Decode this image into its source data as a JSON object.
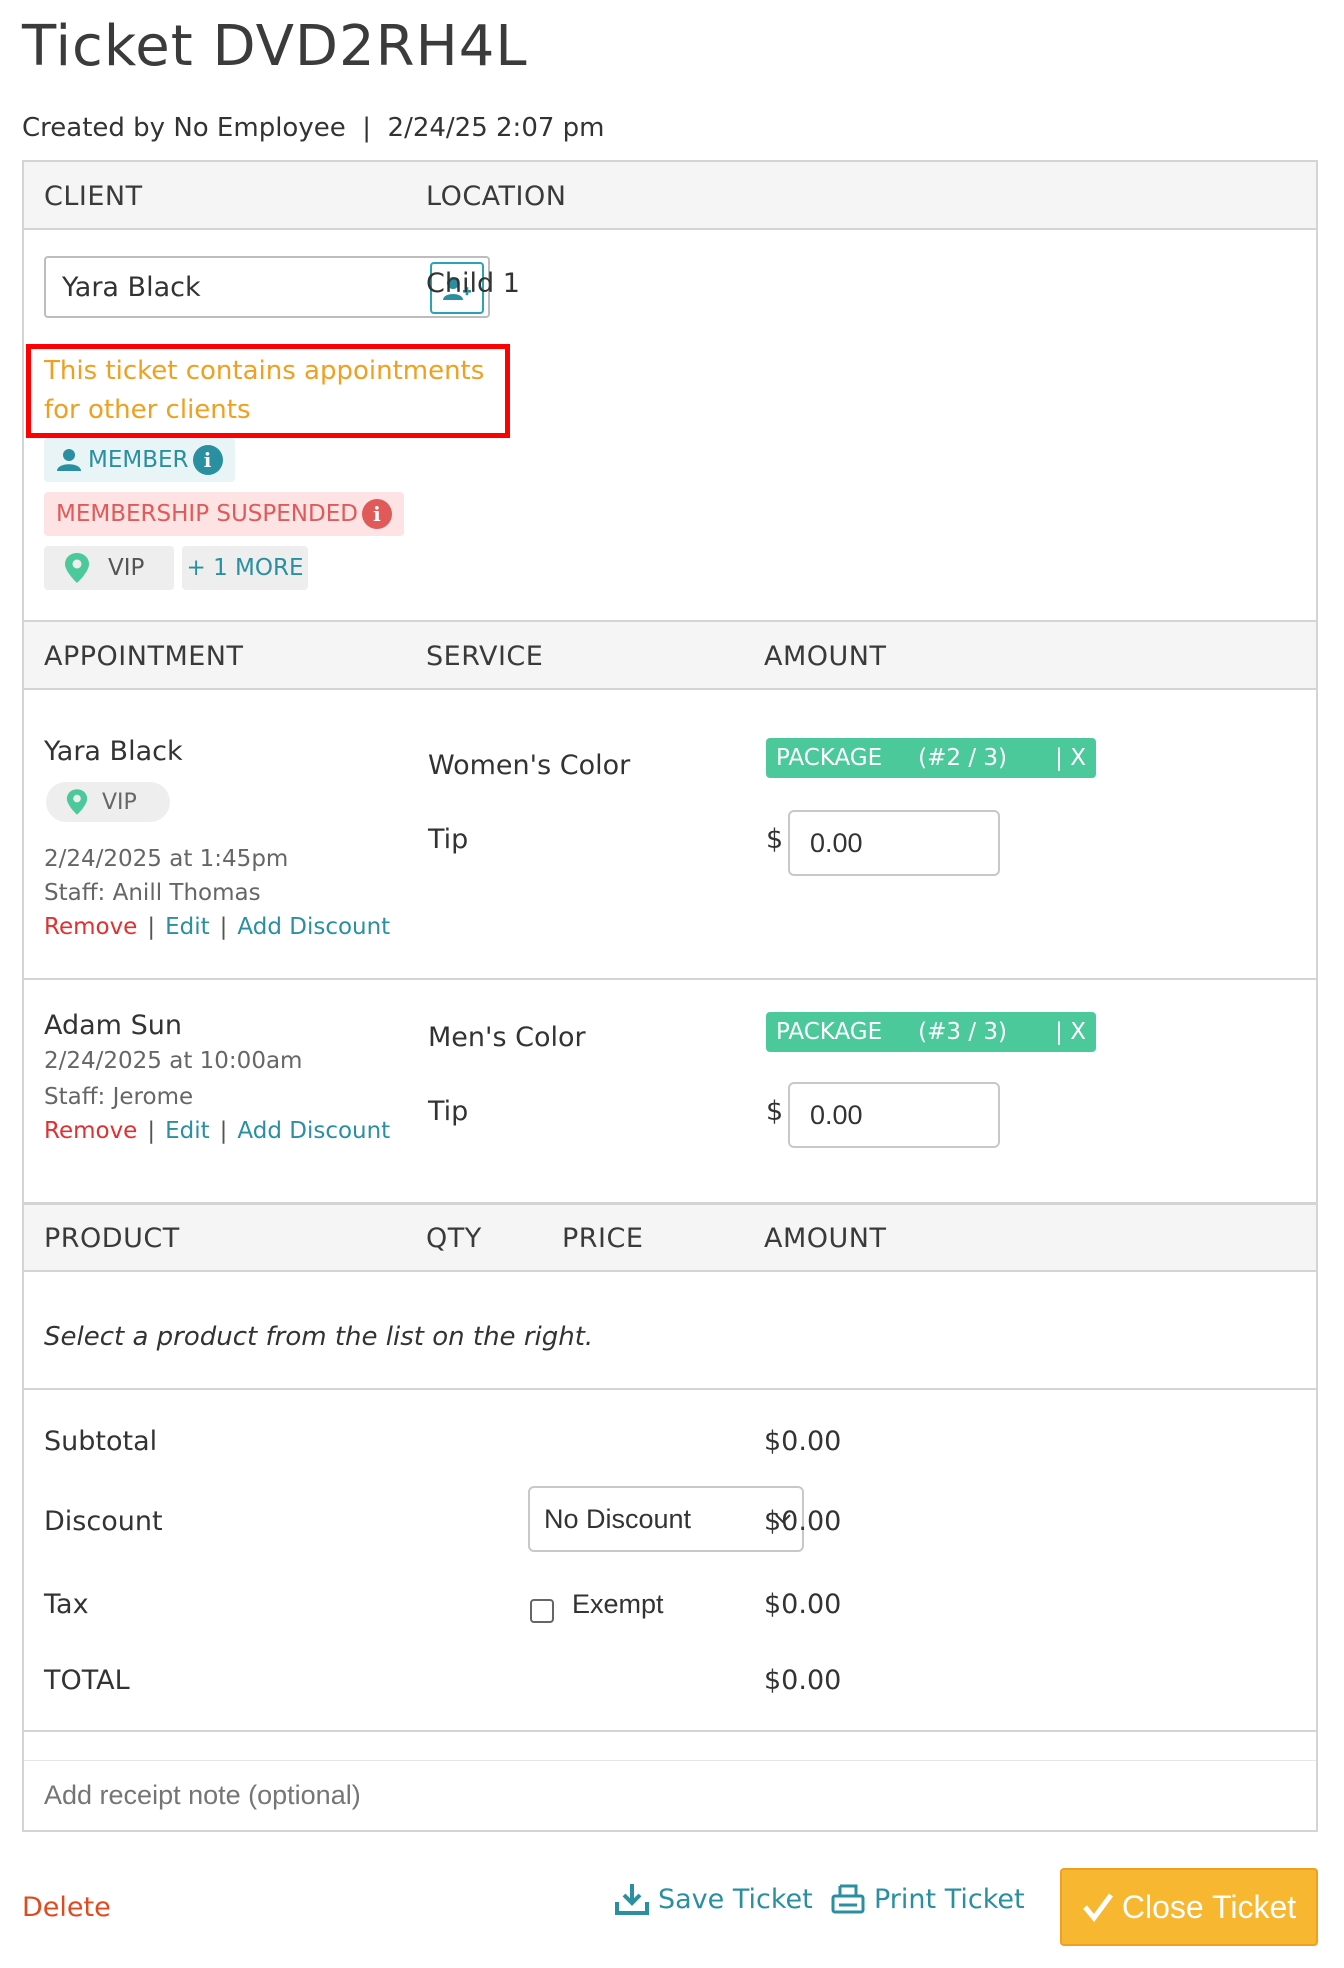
{
  "page": {
    "title": "Ticket DVD2RH4L",
    "created": "Created by No Employee  |  2/24/25 2:07 pm"
  },
  "client_section": {
    "client_header": "CLIENT",
    "location_header": "LOCATION",
    "client_name": "Yara Black",
    "warning": "This ticket contains appointments for other clients",
    "tags": {
      "member": "MEMBER",
      "suspended": "MEMBERSHIP SUSPENDED",
      "vip": "VIP",
      "more": "+ 1 MORE"
    },
    "location": "Child 1"
  },
  "appointments": {
    "headers": {
      "appointment": "APPOINTMENT",
      "service": "SERVICE",
      "amount": "AMOUNT"
    },
    "items": [
      {
        "client": "Yara Black",
        "tag": "VIP",
        "datetime": "2/24/2025 at 1:45pm",
        "staff": "Staff: Anill Thomas",
        "service": "Women's Color",
        "tip_label": "Tip",
        "badge_label": "PACKAGE",
        "badge_count": "(#2 / 3)",
        "badge_close": "| X",
        "currency": "$",
        "tip_value": "0.00"
      },
      {
        "client": "Adam Sun",
        "datetime": "2/24/2025 at 10:00am",
        "staff": "Staff: Jerome",
        "service": "Men's Color",
        "tip_label": "Tip",
        "badge_label": "PACKAGE",
        "badge_count": "(#3 / 3)",
        "badge_close": "| X",
        "currency": "$",
        "tip_value": "0.00"
      }
    ],
    "links": {
      "remove": "Remove",
      "edit": "Edit",
      "add_discount": "Add Discount",
      "sep": "|"
    }
  },
  "products": {
    "headers": {
      "product": "PRODUCT",
      "qty": "QTY",
      "price": "PRICE",
      "amount": "AMOUNT"
    },
    "hint": "Select a product from the list on the right."
  },
  "summary": {
    "subtotal_label": "Subtotal",
    "subtotal": "$0.00",
    "discount_label": "Discount",
    "discount_select": "No Discount",
    "discount": "$0.00",
    "tax_label": "Tax",
    "exempt_label": "Exempt",
    "tax": "$0.00",
    "total_label": "TOTAL",
    "total": "$0.00"
  },
  "receipt_note": {
    "placeholder": "Add receipt note (optional)"
  },
  "footer": {
    "delete": "Delete",
    "save": "Save Ticket",
    "print": "Print Ticket",
    "close": "Close Ticket"
  },
  "colors": {
    "accent": "#2a8fa0",
    "danger": "#e03030",
    "warning": "#f0a020",
    "package": "#4cc99b",
    "close_button": "#f7b731"
  }
}
